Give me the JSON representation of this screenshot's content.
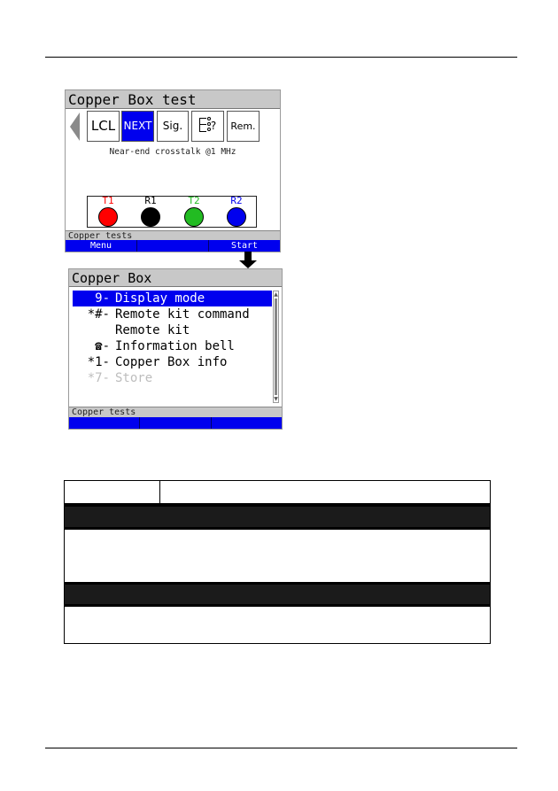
{
  "screen1": {
    "title": "Copper Box test",
    "tabs": [
      {
        "label": "LCL",
        "active": false
      },
      {
        "label": "NEXT",
        "active": true
      },
      {
        "label": "Sig.",
        "active": false
      },
      {
        "label": "?",
        "icon": "line-identification-icon",
        "active": false
      },
      {
        "label": "Rem.",
        "active": false
      }
    ],
    "caption": "Near-end crosstalk @1 MHz",
    "wires": [
      {
        "label": "T1",
        "color": "#ff0000"
      },
      {
        "label": "R1",
        "color": "#000000"
      },
      {
        "label": "T2",
        "color": "#22bb22"
      },
      {
        "label": "R2",
        "color": "#0000ee"
      }
    ],
    "status": "Copper tests",
    "softkeys": [
      "Menu",
      "",
      "Start"
    ]
  },
  "screen2": {
    "title": "Copper Box",
    "menu": [
      {
        "key": "9-",
        "label": "Display mode",
        "selected": true,
        "disabled": false
      },
      {
        "key": "*#-",
        "label": "Remote kit command",
        "selected": false,
        "disabled": false
      },
      {
        "key": "",
        "label": "Remote kit",
        "selected": false,
        "disabled": false
      },
      {
        "key": "☎-",
        "label": "Information bell",
        "selected": false,
        "disabled": false
      },
      {
        "key": "*1-",
        "label": "Copper Box info",
        "selected": false,
        "disabled": false
      },
      {
        "key": "*7-",
        "label": "Store",
        "selected": false,
        "disabled": true
      }
    ],
    "status": "Copper tests",
    "softkeys": [
      "",
      "",
      ""
    ]
  },
  "colors": {
    "accent_blue": "#0000ee",
    "bar_gray": "#c8c8c8",
    "table_dark": "#1b1b1b"
  }
}
